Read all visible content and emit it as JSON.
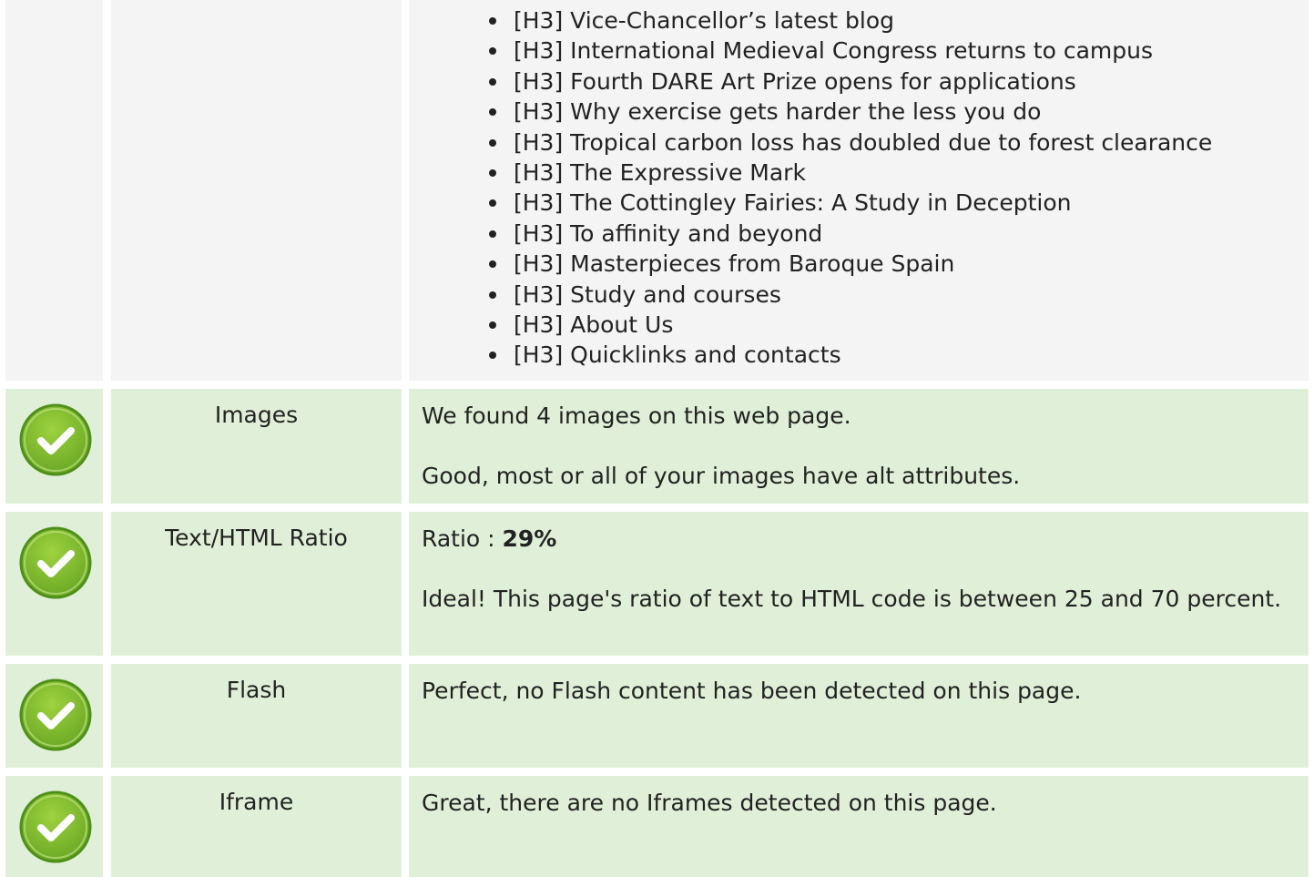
{
  "headings": [
    "[H3] Vice-Chancellor’s latest blog",
    "[H3] International Medieval Congress returns to campus",
    "[H3] Fourth DARE Art Prize opens for applications",
    "[H3] Why exercise gets harder the less you do",
    "[H3] Tropical carbon loss has doubled due to forest clearance",
    "[H3] The Expressive Mark",
    "[H3] The Cottingley Fairies: A Study in Deception",
    "[H3] To affinity and beyond",
    "[H3] Masterpieces from Baroque Spain",
    "[H3] Study and courses",
    "[H3] About Us",
    "[H3] Quicklinks and contacts"
  ],
  "checks": [
    {
      "status_icon": "check-circle-icon",
      "label": "Images",
      "line1": "We found 4 images on this web page.",
      "line2": "Good, most or all of your images have alt attributes."
    },
    {
      "status_icon": "check-circle-icon",
      "label": "Text/HTML Ratio",
      "ratio_prefix": "Ratio : ",
      "ratio_value": "29%",
      "line2": "Ideal! This page's ratio of text to HTML code is between 25 and 70 percent."
    },
    {
      "status_icon": "check-circle-icon",
      "label": "Flash",
      "line1": "Perfect, no Flash content has been detected on this page."
    },
    {
      "status_icon": "check-circle-icon",
      "label": "Iframe",
      "line1": "Great, there are no Iframes detected on this page."
    }
  ],
  "colors": {
    "row_green": "#e0f0d8",
    "row_gray": "#f4f4f4",
    "check_green": "#7cbd2f"
  }
}
